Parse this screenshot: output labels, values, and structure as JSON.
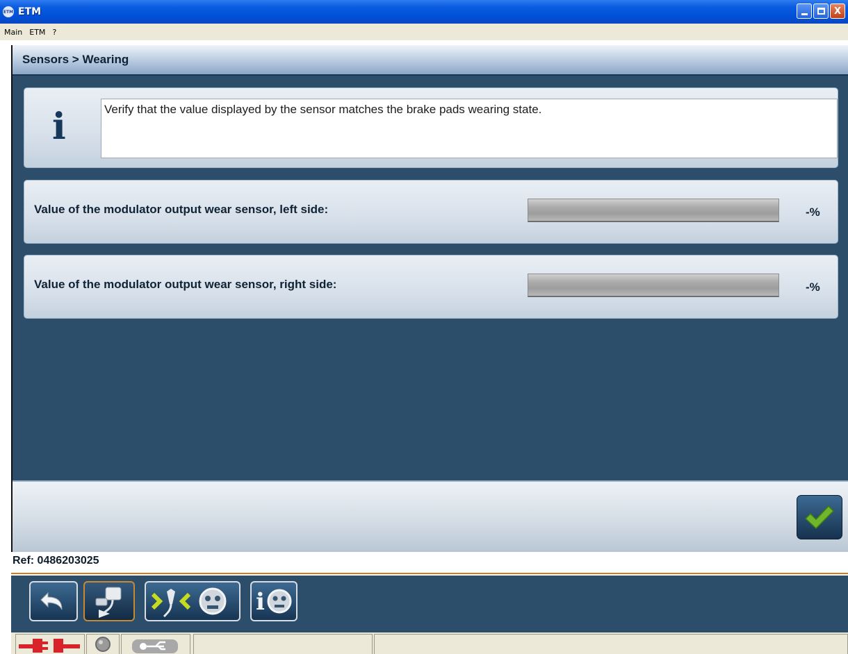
{
  "window": {
    "app_icon_label": "ETM",
    "title": "ETM",
    "controls": [
      "minimize",
      "maximize",
      "close"
    ],
    "close_glyph": "X"
  },
  "menu": [
    "Main",
    "ETM",
    "?"
  ],
  "header": {
    "title": "Sensors > Wearing"
  },
  "info": {
    "icon": "info-icon",
    "glyph": "i",
    "message": "Verify that the value displayed by the sensor matches the brake pads wearing state."
  },
  "sensors": [
    {
      "label": "Value of the modulator output wear sensor, left side:",
      "unit": "-%",
      "level": 0
    },
    {
      "label": "Value of the modulator output wear sensor, right side:",
      "unit": "-%",
      "level": 0
    }
  ],
  "confirm": {
    "icon": "checkmark-icon",
    "color": "#6fb62a"
  },
  "ref": {
    "text": "Ref: 0486203025"
  },
  "toolbar": [
    {
      "icon": "back-arrow-icon"
    },
    {
      "icon": "sensor-connector-icon"
    },
    {
      "icon": "connect-modulator-icon"
    },
    {
      "icon": "info-robot-icon"
    }
  ],
  "statusbar": [
    {
      "icon": "plug-disconnected-icon",
      "color": "#d9232a"
    },
    {
      "icon": "status-led-icon",
      "color": "#9a9a9a"
    },
    {
      "icon": "usb-icon"
    }
  ]
}
